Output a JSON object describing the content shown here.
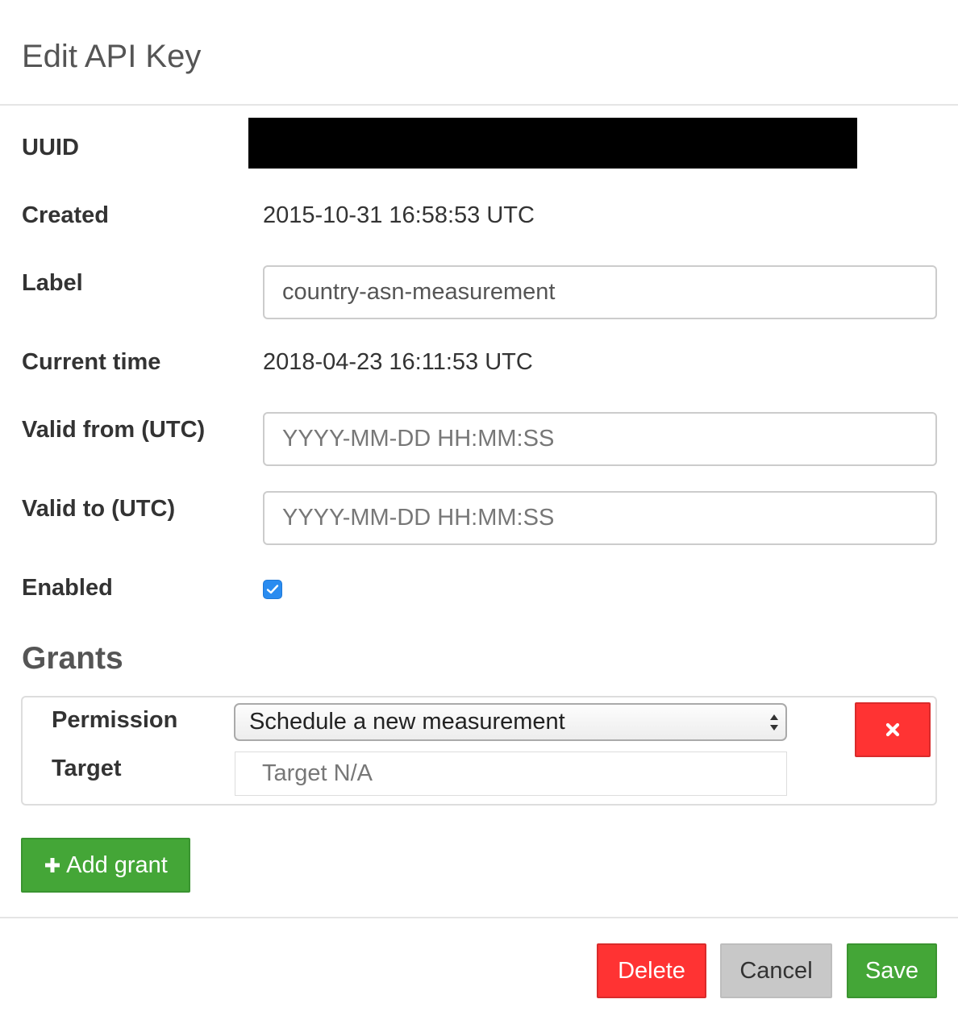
{
  "modal": {
    "title": "Edit API Key"
  },
  "fields": {
    "uuid_label": "UUID",
    "created_label": "Created",
    "created_value": "2015-10-31 16:58:53 UTC",
    "label_label": "Label",
    "label_value": "country-asn-measurement",
    "current_time_label": "Current time",
    "current_time_value": "2018-04-23 16:11:53 UTC",
    "valid_from_label": "Valid from (UTC)",
    "valid_from_placeholder": "YYYY-MM-DD HH:MM:SS",
    "valid_to_label": "Valid to (UTC)",
    "valid_to_placeholder": "YYYY-MM-DD HH:MM:SS",
    "enabled_label": "Enabled",
    "enabled_checked": true
  },
  "grants": {
    "title": "Grants",
    "items": [
      {
        "permission_label": "Permission",
        "permission_value": "Schedule a new measurement",
        "target_label": "Target",
        "target_placeholder": "Target N/A",
        "remove_icon": "close-icon"
      }
    ],
    "add_label": "Add grant",
    "add_icon": "plus-icon"
  },
  "footer": {
    "delete_label": "Delete",
    "cancel_label": "Cancel",
    "save_label": "Save"
  },
  "colors": {
    "danger": "#ff3333",
    "success": "#44a637",
    "neutral": "#c8c8c8",
    "checkbox": "#2a8cf0",
    "redaction": "#000000"
  }
}
